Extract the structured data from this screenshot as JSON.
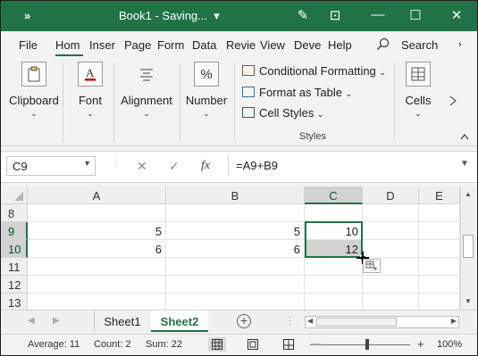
{
  "titlebar": {
    "quick_access": "»",
    "title": "Book1 - Saving...",
    "title_caret": "▾",
    "pen_icon": "✎",
    "ribbon_display_icon": "⊡",
    "minimize": "—",
    "maximize": "☐",
    "close": "✕"
  },
  "tabs": {
    "items": [
      "File",
      "Hom",
      "Inser",
      "Page",
      "Form",
      "Data",
      "Revie",
      "View",
      "Deve",
      "Help"
    ],
    "active": "Hom",
    "search": "Search",
    "more": "›"
  },
  "ribbon": {
    "clipboard": "Clipboard",
    "font": "Font",
    "alignment": "Alignment",
    "number": "Number",
    "number_icon": "%",
    "styles_items": [
      "Conditional Formatting",
      "Format as Table",
      "Cell Styles"
    ],
    "styles_label": "Styles",
    "cells": "Cells",
    "chevron": "⌄"
  },
  "formula_bar": {
    "name_box": "C9",
    "cancel": "✕",
    "enter": "✓",
    "fx": "fx",
    "formula": "=A9+B9"
  },
  "grid": {
    "columns": [
      "A",
      "B",
      "C",
      "D",
      "E"
    ],
    "rows": [
      {
        "num": "8",
        "cells": [
          "",
          "",
          "",
          "",
          ""
        ]
      },
      {
        "num": "9",
        "cells": [
          "5",
          "5",
          "10",
          "",
          ""
        ]
      },
      {
        "num": "10",
        "cells": [
          "6",
          "6",
          "12",
          "",
          ""
        ]
      },
      {
        "num": "11",
        "cells": [
          "",
          "",
          "",
          "",
          ""
        ]
      },
      {
        "num": "12",
        "cells": [
          "",
          "",
          "",
          "",
          ""
        ]
      },
      {
        "num": "13",
        "cells": [
          "",
          "",
          "",
          "",
          ""
        ]
      }
    ],
    "selected_range": "C9:C10",
    "selection_color": "#217346"
  },
  "sheets": {
    "tabs": [
      "Sheet1",
      "Sheet2"
    ],
    "active": "Sheet2",
    "add": "+"
  },
  "status": {
    "average": "Average: 11",
    "count": "Count: 2",
    "sum": "Sum: 22",
    "zoom": "100%",
    "minus": "—",
    "plus": "+"
  },
  "colors": {
    "accent": "#217346"
  }
}
